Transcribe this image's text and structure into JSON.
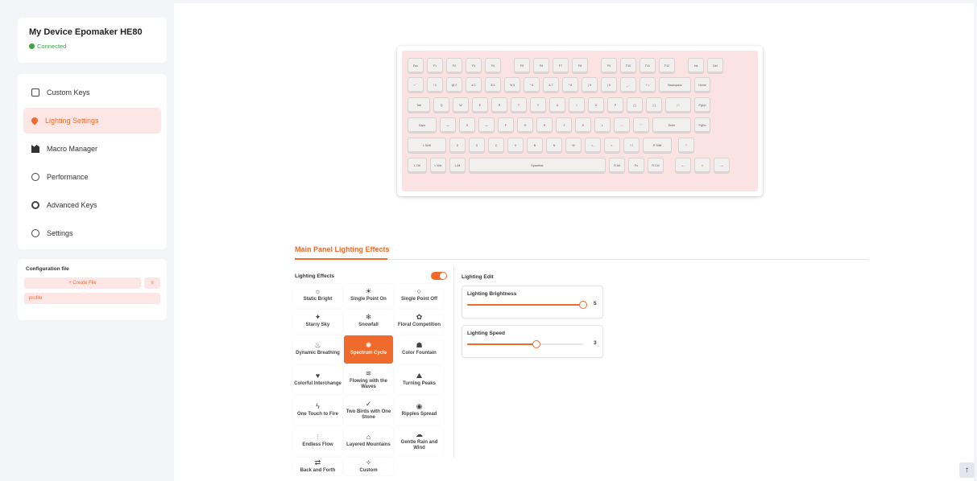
{
  "device": {
    "title": "My Device Epomaker HE80",
    "status": "Connected"
  },
  "nav": {
    "items": [
      {
        "label": "Custom Keys",
        "icon": "keys-icon"
      },
      {
        "label": "Lighting Settings",
        "icon": "lighting-icon"
      },
      {
        "label": "Macro Manager",
        "icon": "macro-icon"
      },
      {
        "label": "Performance",
        "icon": "performance-icon"
      },
      {
        "label": "Advanced Keys",
        "icon": "advanced-keys-icon"
      },
      {
        "label": "Settings",
        "icon": "settings-icon"
      }
    ],
    "active": "Lighting Settings"
  },
  "config": {
    "title": "Configuration file",
    "create_label": "+ Create File",
    "menu_label": "≡",
    "profile_label": "profile"
  },
  "keyboard": {
    "rows": [
      [
        "Esc",
        "F1",
        "F2",
        "F3",
        "F4",
        "F5",
        "F6",
        "F7",
        "F8",
        "F9",
        "F10",
        "F11",
        "F12",
        "Ins",
        "Del"
      ],
      [
        "~ `",
        "! 1",
        "@ 2",
        "# 3",
        "$ 4",
        "% 5",
        "^ 6",
        "& 7",
        "* 8",
        "( 9",
        ") 0",
        "_ -",
        "+ =",
        "Backspace",
        "Home"
      ],
      [
        "Tab",
        "Q",
        "W",
        "E",
        "R",
        "T",
        "Y",
        "U",
        "I",
        "O",
        "P",
        "{ [",
        "} ]",
        "| \\",
        "PgUp"
      ],
      [
        "Caps",
        "↔",
        "S",
        "↔",
        "F",
        "G",
        "H",
        "J",
        "K",
        "L",
        ": ;",
        "\" '",
        "Enter",
        "PgDn"
      ],
      [
        "L Shift",
        "Z",
        "X",
        "C",
        "V",
        "B",
        "N",
        "M",
        "< ,",
        "> .",
        "? /",
        "R Shift",
        "↑"
      ],
      [
        "L Ctrl",
        "L Win",
        "L Alt",
        "Spacebar",
        "R Alt",
        "Fn",
        "R Ctrl",
        "←",
        "↓",
        "→"
      ]
    ]
  },
  "lighting": {
    "tab_title": "Main Panel Lighting Effects",
    "effects_label": "Lighting Effects",
    "effects_enabled": true,
    "effects": [
      {
        "label": "Static Bright",
        "icon": "sun-icon"
      },
      {
        "label": "Single Point On",
        "icon": "bulb-on-icon"
      },
      {
        "label": "Single Point Off",
        "icon": "bulb-off-icon"
      },
      {
        "label": "Starry Sky",
        "icon": "stars-icon"
      },
      {
        "label": "Snowfall",
        "icon": "snowfall-icon"
      },
      {
        "label": "Floral Competition",
        "icon": "flower-icon"
      },
      {
        "label": "Dynamic Breathing",
        "icon": "breathing-icon"
      },
      {
        "label": "Spectrum Cycle",
        "icon": "spectrum-icon"
      },
      {
        "label": "Color Fountain",
        "icon": "fountain-icon"
      },
      {
        "label": "Colorful Interchange",
        "icon": "heart-icon"
      },
      {
        "label": "Flowing with the Waves",
        "icon": "waves-icon"
      },
      {
        "label": "Turning Peaks",
        "icon": "peaks-icon"
      },
      {
        "label": "One Touch to Fire",
        "icon": "fire-icon"
      },
      {
        "label": "Two Birds with One Stone",
        "icon": "birds-icon"
      },
      {
        "label": "Ripples Spread",
        "icon": "ripples-icon"
      },
      {
        "label": "Endless Flow",
        "icon": "flow-icon"
      },
      {
        "label": "Layered Mountains",
        "icon": "mountains-icon"
      },
      {
        "label": "Gentle Rain and Wind",
        "icon": "rain-icon"
      },
      {
        "label": "Back and Forth",
        "icon": "back-forth-icon"
      },
      {
        "label": "Custom",
        "icon": "custom-icon"
      }
    ],
    "selected_effect": "Spectrum Cycle",
    "edit_label": "Lighting Edit",
    "brightness": {
      "label": "Lighting Brightness",
      "value": "5",
      "max": 5
    },
    "speed": {
      "label": "Lighting Speed",
      "value": "3",
      "max": 5
    }
  },
  "colors": {
    "accent": "#f06a2b",
    "accent_light": "#fde6e6",
    "connected": "#43a047",
    "keyboard_case": "#fbe3e3"
  }
}
